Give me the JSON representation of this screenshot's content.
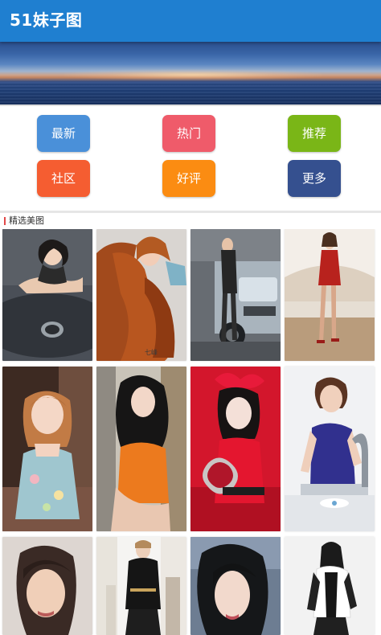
{
  "app_bar": {
    "title": "51妹子图",
    "color": "#1f7fd0"
  },
  "banner": {
    "description": ""
  },
  "menu": {
    "buttons": [
      {
        "label": "最新",
        "color": "#4a90d9"
      },
      {
        "label": "热门",
        "color": "#ef5b6a"
      },
      {
        "label": "推荐",
        "color": "#7ab617"
      },
      {
        "label": "社区",
        "color": "#f55d31"
      },
      {
        "label": "好评",
        "color": "#fb8c12"
      },
      {
        "label": "更多",
        "color": "#35508f"
      }
    ]
  },
  "featured": {
    "title": "精选美图",
    "marker_color": "#e24848",
    "photos": [
      {
        "id": "p1",
        "watermark": ""
      },
      {
        "id": "p2",
        "watermark": "七峰"
      },
      {
        "id": "p3",
        "watermark": ""
      },
      {
        "id": "p4",
        "watermark": ""
      },
      {
        "id": "p5",
        "watermark": ""
      },
      {
        "id": "p6",
        "watermark": ""
      },
      {
        "id": "p7",
        "watermark": ""
      },
      {
        "id": "p8",
        "watermark": ""
      },
      {
        "id": "p9",
        "watermark": ""
      },
      {
        "id": "p10",
        "watermark": ""
      },
      {
        "id": "p11",
        "watermark": ""
      },
      {
        "id": "p12",
        "watermark": ""
      }
    ]
  }
}
